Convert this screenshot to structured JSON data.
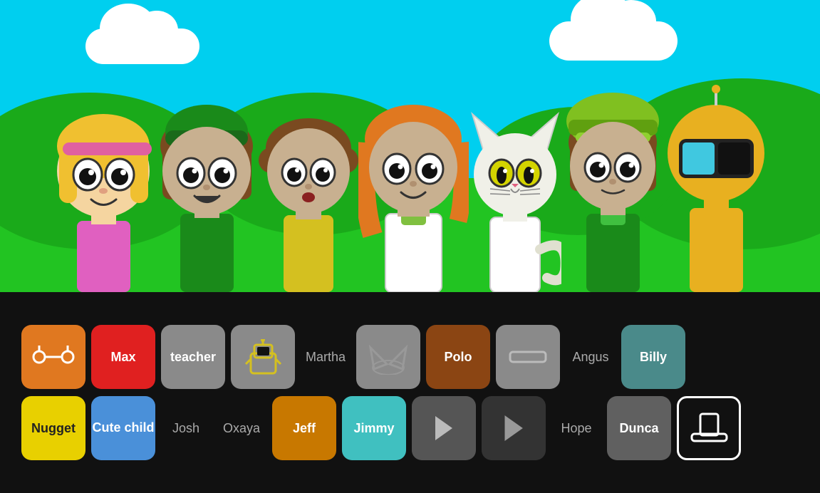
{
  "scene": {
    "characters": [
      {
        "name": "char1",
        "label": ""
      },
      {
        "name": "char2",
        "label": ""
      },
      {
        "name": "char3",
        "label": ""
      },
      {
        "name": "char4",
        "label": ""
      },
      {
        "name": "char5",
        "label": ""
      },
      {
        "name": "char6",
        "label": ""
      },
      {
        "name": "char7",
        "label": ""
      }
    ]
  },
  "panel": {
    "row1": [
      {
        "id": "max-btn",
        "type": "colored",
        "color": "orange",
        "label": "Max",
        "hasIcon": true,
        "iconType": "antennae"
      },
      {
        "id": "max-label",
        "type": "label-only",
        "label": "Max"
      },
      {
        "id": "teacher-btn",
        "type": "colored",
        "color": "gray",
        "label": "teacher"
      },
      {
        "id": "teacher-robot-btn",
        "type": "colored",
        "color": "gray",
        "label": "",
        "hasIcon": true,
        "iconType": "robot"
      },
      {
        "id": "martha-label",
        "type": "label-only",
        "label": "Martha"
      },
      {
        "id": "polo-icon-btn",
        "type": "colored",
        "color": "gray",
        "label": "",
        "hasIcon": true,
        "iconType": "cat-ears"
      },
      {
        "id": "polo-btn",
        "type": "colored",
        "color": "brown",
        "label": "Polo"
      },
      {
        "id": "angus-icon-btn",
        "type": "colored",
        "color": "gray",
        "label": "",
        "hasIcon": true,
        "iconType": "rectangle"
      },
      {
        "id": "angus-label",
        "type": "label-only",
        "label": "Angus"
      },
      {
        "id": "billy-btn",
        "type": "colored",
        "color": "teal",
        "label": "Billy"
      }
    ],
    "row2": [
      {
        "id": "nugget-btn",
        "type": "colored",
        "color": "yellow",
        "label": "Nugget"
      },
      {
        "id": "cute-child-btn",
        "type": "colored",
        "color": "blue",
        "label": "Cute child",
        "multiline": true
      },
      {
        "id": "josh-label",
        "type": "label-only",
        "label": "Josh"
      },
      {
        "id": "oxaya-label",
        "type": "label-only",
        "label": "Oxaya"
      },
      {
        "id": "jeff-btn",
        "type": "colored",
        "color": "amber",
        "label": "Jeff"
      },
      {
        "id": "jimmy-btn",
        "type": "colored",
        "color": "cyan",
        "label": "Jimmy"
      },
      {
        "id": "hope-arrow1",
        "type": "icon-gray",
        "label": "",
        "hasIcon": true,
        "iconType": "arrow-right"
      },
      {
        "id": "hope-arrow2",
        "type": "icon-dark",
        "label": "",
        "hasIcon": true,
        "iconType": "arrow-right-thin"
      },
      {
        "id": "hope-label",
        "type": "label-only",
        "label": "Hope"
      },
      {
        "id": "dunca-btn",
        "type": "colored",
        "color": "darkgray",
        "label": "Dunca"
      },
      {
        "id": "hat-btn",
        "type": "outline",
        "label": "",
        "hasIcon": true,
        "iconType": "hat"
      }
    ]
  }
}
